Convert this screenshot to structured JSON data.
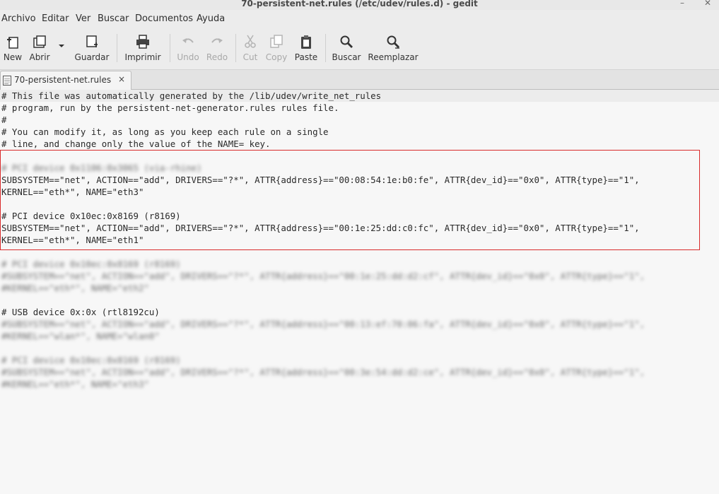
{
  "window": {
    "title": "70-persistent-net.rules (/etc/udev/rules.d) - gedit",
    "minimize_glyph": "–",
    "close_glyph": "✕"
  },
  "menu": [
    "Archivo",
    "Editar",
    "Ver",
    "Buscar",
    "Documentos",
    "Ayuda"
  ],
  "toolbar": {
    "new": "New",
    "open": "Abrir",
    "save": "Guardar",
    "print": "Imprimir",
    "undo": "Undo",
    "redo": "Redo",
    "cut": "Cut",
    "copy": "Copy",
    "paste": "Paste",
    "find": "Buscar",
    "replace": "Reemplazar"
  },
  "tab": {
    "label": "70-persistent-net.rules",
    "close_glyph": "×"
  },
  "editor": {
    "lines": [
      "# This file was automatically generated by the /lib/udev/write_net_rules",
      "# program, run by the persistent-net-generator.rules rules file.",
      "#",
      "# You can modify it, as long as you keep each rule on a single",
      "# line, and change only the value of the NAME= key.",
      "",
      "# PCI device 0x1106:0x3065 (via-rhine)",
      "SUBSYSTEM==\"net\", ACTION==\"add\", DRIVERS==\"?*\", ATTR{address}==\"00:08:54:1e:b0:fe\", ATTR{dev_id}==\"0x0\", ATTR{type}==\"1\",",
      "KERNEL==\"eth*\", NAME=\"eth3\"",
      "",
      "# PCI device 0x10ec:0x8169 (r8169)",
      "SUBSYSTEM==\"net\", ACTION==\"add\", DRIVERS==\"?*\", ATTR{address}==\"00:1e:25:dd:c0:fc\", ATTR{dev_id}==\"0x0\", ATTR{type}==\"1\",",
      "KERNEL==\"eth*\", NAME=\"eth1\"",
      "",
      "# PCI device 0x10ec:0x8169 (r8169)",
      "#SUBSYSTEM==\"net\", ACTION==\"add\", DRIVERS==\"?*\", ATTR{address}==\"00:1e:25:dd:d2:cf\", ATTR{dev_id}==\"0x0\", ATTR{type}==\"1\",",
      "#KERNEL==\"eth*\", NAME=\"eth2\"",
      "",
      "# USB device 0x:0x (rtl8192cu)",
      "#SUBSYSTEM==\"net\", ACTION==\"add\", DRIVERS==\"?*\", ATTR{address}==\"00:13:ef:70:06:fa\", ATTR{dev_id}==\"0x0\", ATTR{type}==\"1\",",
      "#KERNEL==\"wlan*\", NAME=\"wlan0\"",
      "",
      "# PCI device 0x10ec:0x8169 (r8169)",
      "#SUBSYSTEM==\"net\", ACTION==\"add\", DRIVERS==\"?*\", ATTR{address}==\"00:3e:54:dd:d2:ce\", ATTR{dev_id}==\"0x0\", ATTR{type}==\"1\",",
      "#KERNEL==\"eth*\", NAME=\"eth3\""
    ]
  },
  "colors": {
    "highlight_border": "#d92b2b"
  }
}
